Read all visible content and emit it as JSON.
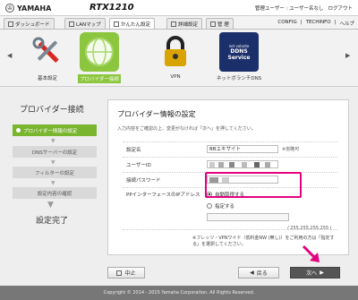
{
  "header": {
    "brand": "YAMAHA",
    "model": "RTX1210",
    "user_info": "管理ユーザー : ユーザー名なし",
    "logout": "ログアウト"
  },
  "tabs": [
    {
      "label": "ダッシュボード"
    },
    {
      "label": "LANマップ"
    },
    {
      "label": "かんたん設定"
    },
    {
      "label": "詳細設定"
    },
    {
      "label": "管 理"
    }
  ],
  "top_links": {
    "config": "CONFIG",
    "techinfo": "TECHINFO",
    "help": "ヘルプ"
  },
  "quick_icons": [
    {
      "label": "基本設定"
    },
    {
      "label": "プロバイダー接続"
    },
    {
      "label": "VPN"
    },
    {
      "label": "ネットボランチDNS",
      "badge_small": "net volante",
      "badge_big": "DDNS Service"
    }
  ],
  "sidebar": {
    "title": "プロバイダー接続",
    "steps": [
      {
        "label": "プロバイダー情報の設定"
      },
      {
        "label": "DNSサーバーの設定"
      },
      {
        "label": "フィルターの設定"
      },
      {
        "label": "設定内容の確認"
      }
    ],
    "done": "設定完了"
  },
  "form": {
    "title": "プロバイダー情報の設定",
    "instruction": "入力内容をご確認の上、変更がなければ「次へ」を押してください。",
    "fields": {
      "setting_name_label": "設定名",
      "setting_name_value": "BBエキサイト",
      "optional": "※省略可",
      "user_id_label": "ユーザーID",
      "password_label": "接続パスワード",
      "pp_ip_label": "PPインターフェースのIPアドレス",
      "auto_label": "自動取得する",
      "manual_label": "指定する",
      "netmask": "/ 255.255.255.255 (",
      "note": "※フレッツ・VPNワイド（低料金NW (無し)）をご利用の方は「指定する」を選択してください。"
    }
  },
  "buttons": {
    "cancel": "中止",
    "back": "戻る",
    "next": "次へ"
  },
  "footer": "Copyright © 2014 - 2015 Yamaha Corporation. All Rights Reserved.",
  "colors": {
    "accent_green": "#8cc63f",
    "highlight": "#e5007e"
  }
}
